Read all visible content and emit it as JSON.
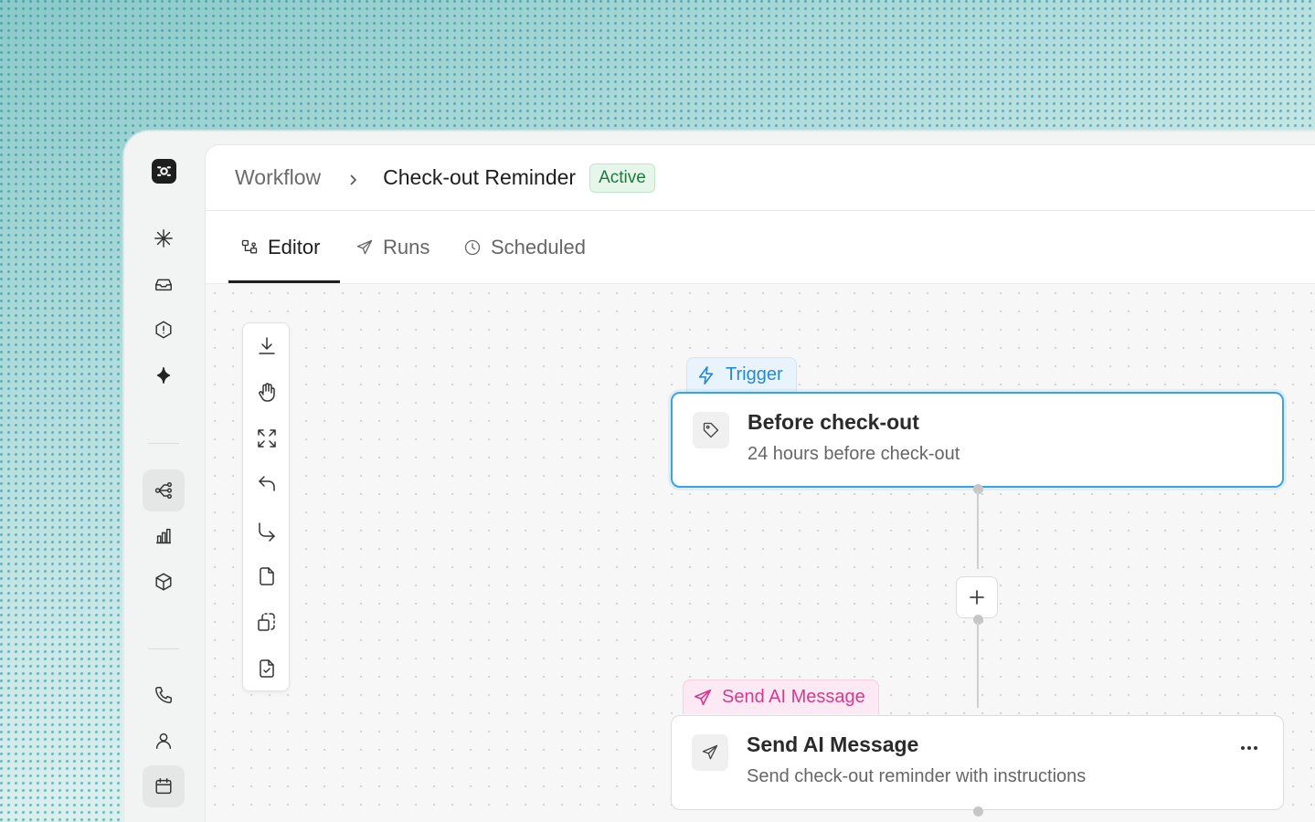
{
  "breadcrumb": {
    "parent": "Workflow",
    "title": "Check-out Reminder",
    "status": "Active"
  },
  "tabs": [
    {
      "label": "Editor",
      "icon": "editor-icon",
      "active": true
    },
    {
      "label": "Runs",
      "icon": "send-icon",
      "active": false
    },
    {
      "label": "Scheduled",
      "icon": "clock-icon",
      "active": false
    }
  ],
  "rail": {
    "items": [
      {
        "icon": "asterisk-icon"
      },
      {
        "icon": "inbox-icon"
      },
      {
        "icon": "alert-hexagon-icon"
      },
      {
        "icon": "sparkle-icon"
      },
      {
        "icon": "workflow-icon",
        "active": true
      },
      {
        "icon": "bar-chart-icon"
      },
      {
        "icon": "cube-icon"
      },
      {
        "icon": "phone-icon"
      },
      {
        "icon": "user-icon"
      },
      {
        "icon": "calendar-icon"
      }
    ]
  },
  "toolbar": {
    "tools": [
      "download-icon",
      "hand-icon",
      "fit-view-icon",
      "undo-icon",
      "redo-icon",
      "file-icon",
      "duplicate-icon",
      "file-check-icon"
    ]
  },
  "flow": {
    "trigger": {
      "chip_label": "Trigger",
      "title": "Before check-out",
      "subtitle": "24 hours before check-out"
    },
    "action": {
      "chip_label": "Send AI Message",
      "title": "Send AI Message",
      "subtitle": "Send check-out reminder with instructions"
    }
  },
  "colors": {
    "accent_trigger": "#2489d6",
    "accent_action": "#d63a8c",
    "status_active": "#1f7a3e"
  }
}
